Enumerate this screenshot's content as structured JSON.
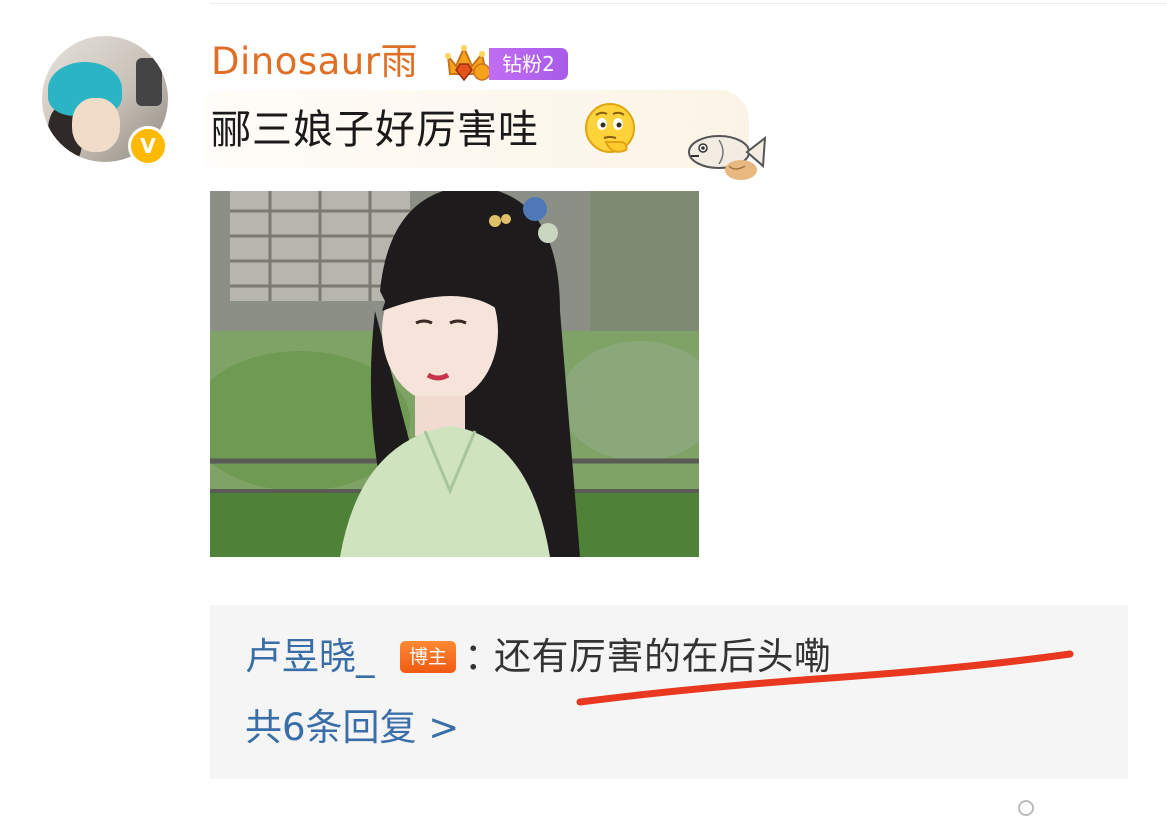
{
  "comment": {
    "username": "Dinosaur雨",
    "fan_badge": "钻粉2",
    "text": "郦三娘子好厉害哇",
    "emoji": "thinking-face-emoji",
    "sticker": "fish-sticker",
    "image": "photo of woman in traditional hanfu, long black hair, green garment"
  },
  "reply": {
    "author": "卢昱晓_",
    "author_badge": "博主",
    "colon": "：",
    "text": "还有厉害的在后头嘞",
    "count_label": "共6条回复 >"
  },
  "colors": {
    "username": "#e06f25",
    "link": "#3a6ea8",
    "fan_badge": "#b066ee",
    "blogger_badge": "#f2661c",
    "underline_annotation": "#e8381f"
  }
}
